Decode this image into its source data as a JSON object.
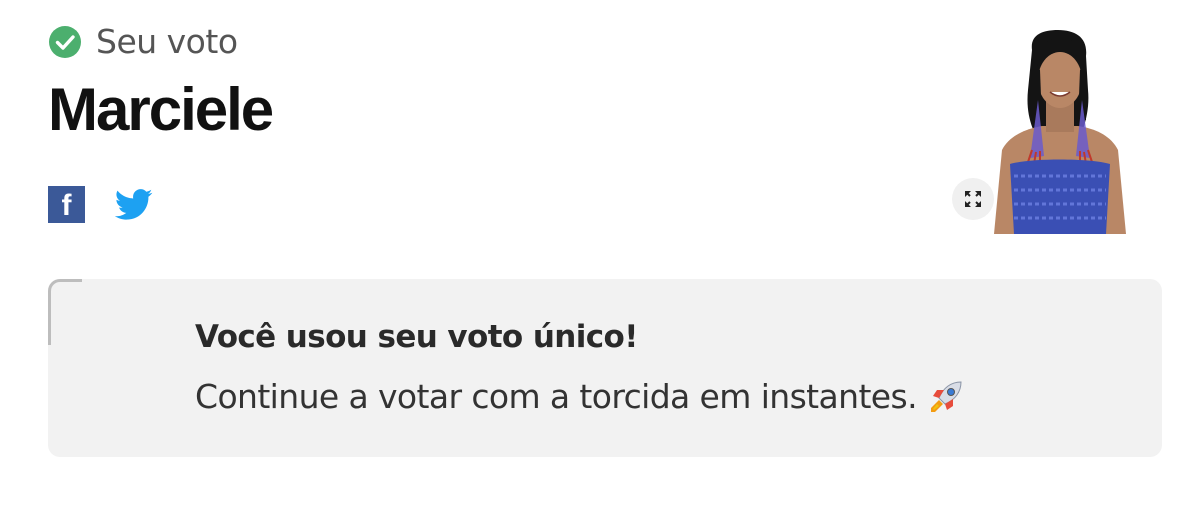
{
  "vote": {
    "status_label": "Seu voto",
    "candidate_name": "Marciele"
  },
  "share": {
    "facebook_glyph": "f",
    "icons": [
      "facebook-icon",
      "twitter-icon"
    ]
  },
  "photo": {
    "expand_icon": "expand-icon"
  },
  "notice": {
    "title": "Você usou seu voto único!",
    "message": "Continue a votar com a torcida em instantes.",
    "emoji_icon": "rocket-icon"
  },
  "colors": {
    "check_green": "#4caf6e",
    "facebook_blue": "#3b5998",
    "twitter_blue": "#1da1f2",
    "notice_bg": "#f2f2f2"
  }
}
